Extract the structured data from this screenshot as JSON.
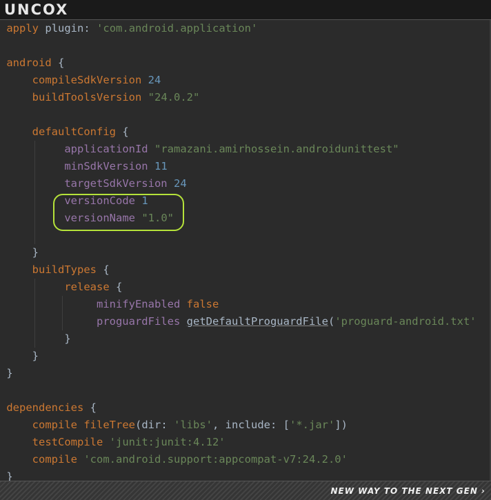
{
  "header": {
    "logo_text": "UNCOX"
  },
  "footer": {
    "tagline": "NEW WAY TO THE NEXT GEN ›"
  },
  "code": {
    "l1_kw": "apply",
    "l1_mid": "plugin:",
    "l1_str": "'com.android.application'",
    "l3_kw": "android",
    "l3_brace": "{",
    "l4_prop": "compileSdkVersion",
    "l4_num": "24",
    "l5_prop": "buildToolsVersion",
    "l5_str": "\"24.0.2\"",
    "l7_prop": "defaultConfig",
    "l7_brace": "{",
    "l8_prop": "applicationId",
    "l8_str": "\"ramazani.amirhossein.androidunittest\"",
    "l9_prop": "minSdkVersion",
    "l9_num": "11",
    "l10_prop": "targetSdkVersion",
    "l10_num": "24",
    "l11_prop": "versionCode",
    "l11_num": "1",
    "l12_prop": "versionName",
    "l12_str": "\"1.0\"",
    "l14_brace": "}",
    "l15_prop": "buildTypes",
    "l15_brace": "{",
    "l16_prop": "release",
    "l16_brace": "{",
    "l17_prop": "minifyEnabled",
    "l17_bool": "false",
    "l18_prop": "proguardFiles",
    "l18_fn": "getDefaultProguardFile",
    "l18_open": "(",
    "l18_str": "'proguard-android.txt'",
    "l19_brace": "}",
    "l20_brace": "}",
    "l21_brace": "}",
    "l23_kw": "dependencies",
    "l23_brace": "{",
    "l24_prop": "compile",
    "l24_fn": "fileTree",
    "l24_a": "(dir:",
    "l24_s1": "'libs'",
    "l24_b": ", include: [",
    "l24_s2": "'*.jar'",
    "l24_c": "])",
    "l25_prop": "testCompile",
    "l25_str": "'junit:junit:4.12'",
    "l26_prop": "compile",
    "l26_str": "'com.android.support:appcompat-v7:24.2.0'",
    "l27_brace": "}"
  }
}
